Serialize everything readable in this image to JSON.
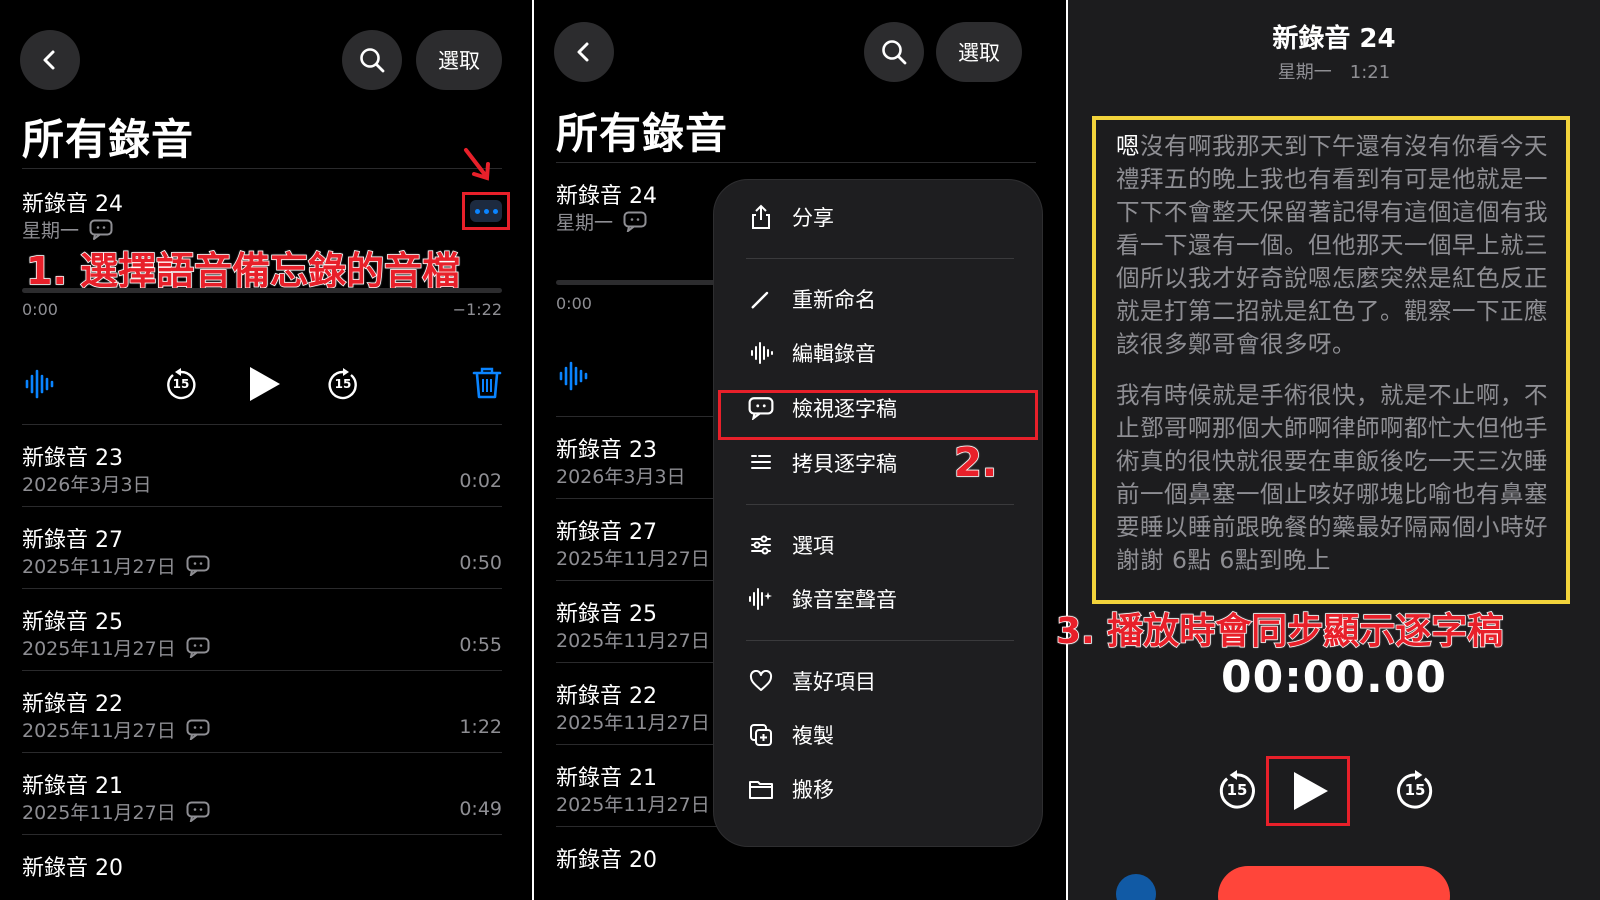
{
  "panel1": {
    "select_label": "選取",
    "title": "所有錄音",
    "expanded": {
      "title": "新錄音 24",
      "day": "星期一",
      "time_start": "0:00",
      "time_remaining": "−1:22",
      "skip_back_label": "15",
      "skip_fwd_label": "15"
    },
    "annotation": "1. 選擇語音備忘錄的音檔",
    "recordings": [
      {
        "title": "新錄音 23",
        "date": "2026年3月3日",
        "duration": "0:02",
        "transcript_icon": false
      },
      {
        "title": "新錄音 27",
        "date": "2025年11月27日",
        "duration": "0:50",
        "transcript_icon": true
      },
      {
        "title": "新錄音 25",
        "date": "2025年11月27日",
        "duration": "0:55",
        "transcript_icon": true
      },
      {
        "title": "新錄音 22",
        "date": "2025年11月27日",
        "duration": "1:22",
        "transcript_icon": true
      },
      {
        "title": "新錄音 21",
        "date": "2025年11月27日",
        "duration": "0:49",
        "transcript_icon": true
      },
      {
        "title": "新錄音 20",
        "date": "",
        "duration": "",
        "transcript_icon": false
      }
    ]
  },
  "panel2": {
    "select_label": "選取",
    "title": "所有錄音",
    "expanded": {
      "title": "新錄音 24",
      "day": "星期一",
      "time_start": "0:00"
    },
    "recordings": [
      {
        "title": "新錄音 23",
        "date": "2026年3月3日"
      },
      {
        "title": "新錄音 27",
        "date": "2025年11月27日"
      },
      {
        "title": "新錄音 25",
        "date": "2025年11月27日"
      },
      {
        "title": "新錄音 22",
        "date": "2025年11月27日"
      },
      {
        "title": "新錄音 21",
        "date": "2025年11月27日"
      },
      {
        "title": "新錄音 20",
        "date": ""
      }
    ],
    "menu": {
      "share": "分享",
      "rename": "重新命名",
      "edit": "編輯錄音",
      "view_transcript": "檢視逐字稿",
      "copy_transcript": "拷貝逐字稿",
      "options": "選項",
      "studio": "錄音室聲音",
      "favorite": "喜好項目",
      "duplicate": "複製",
      "move": "搬移"
    },
    "annotation": "2."
  },
  "panel3": {
    "title": "新錄音 24",
    "subtitle": "星期一　1:21",
    "transcript_first_word": "嗯",
    "transcript_p1_rest": "沒有啊我那天到下午還有沒有你看今天禮拜五的晚上我也有看到有可是他就是一下下不會整天保留著記得有這個這個有我看一下還有一個。但他那天一個早上就三個所以我才好奇說嗯怎麼突然是紅色反正就是打第二招就是紅色了。觀察一下正應該很多鄭哥會很多呀。",
    "transcript_p2": "我有時候就是手術很快，就是不止啊，不止鄧哥啊那個大師啊律師啊都忙大但他手術真的很快就很要在車飯後吃一天三次睡前一個鼻塞一個止咳好哪塊比喻也有鼻塞要睡以睡前跟晚餐的藥最好隔兩個小時好謝謝 6點 6點到晚上",
    "annotation": "3. 播放時會同步顯示逐字稿",
    "timer": "00:00.00",
    "skip_back_label": "15",
    "skip_fwd_label": "15"
  },
  "colors": {
    "accent_blue": "#0a84ff",
    "annotation_red": "#e8202a",
    "highlight_yellow": "#f2d33b",
    "record_red": "#ff453a"
  }
}
